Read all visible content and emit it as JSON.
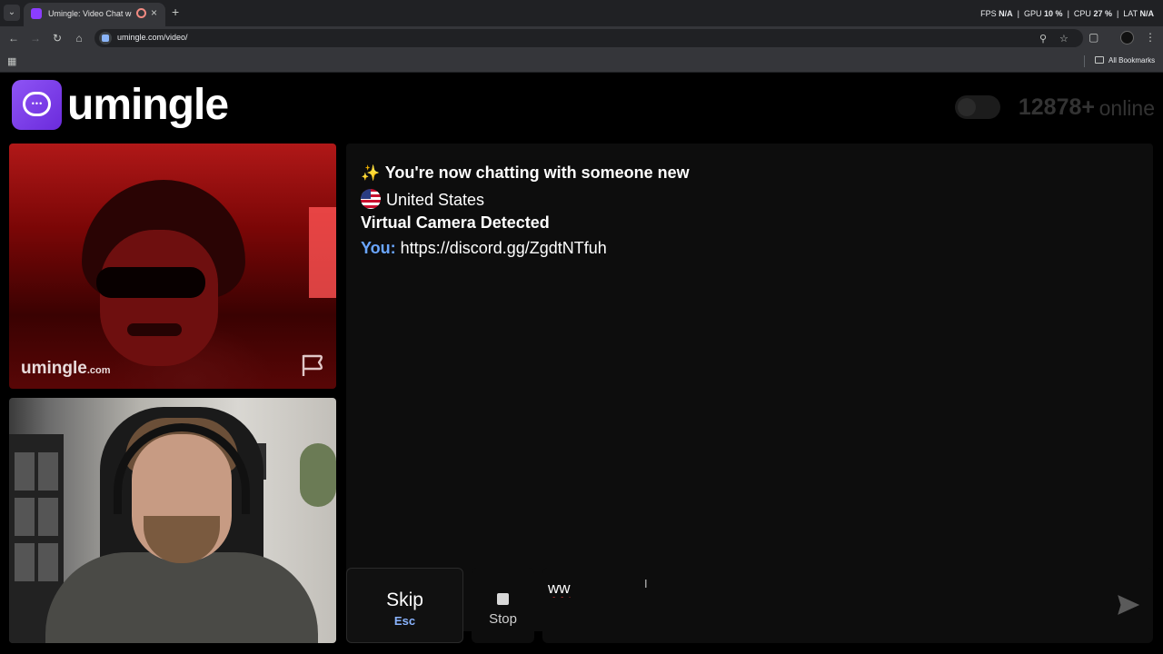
{
  "browser": {
    "tab_title": "Umingle: Video Chat with S",
    "url": "umingle.com/video/",
    "stats": {
      "fps_label": "FPS",
      "fps_value": "N/A",
      "gpu_label": "GPU",
      "gpu_value": "10 %",
      "cpu_label": "CPU",
      "cpu_value": "27 %",
      "lat_label": "LAT",
      "lat_value": "N/A"
    },
    "bookmarks_label": "All Bookmarks",
    "icons": [
      "tab-menu-icon",
      "close-icon",
      "new-tab-icon",
      "back-icon",
      "forward-icon",
      "reload-icon",
      "home-icon",
      "zoom-icon",
      "star-icon",
      "extensions-icon",
      "menu-icon",
      "apps-icon",
      "folder-icon"
    ]
  },
  "header": {
    "logo_text": "umingle",
    "online_count": "12878+",
    "online_label": "online"
  },
  "stranger_video": {
    "brand": "umingle",
    "brand_suffix": ".com"
  },
  "chat": {
    "connected_message": "You're now chatting with someone new",
    "country": "United States",
    "warning": "Virtual Camera Detected",
    "you_label": "You:",
    "you_message": "https://discord.gg/ZgdtNTfuh"
  },
  "controls": {
    "skip_label": "Skip",
    "skip_key": "Esc",
    "stop_label": "Stop",
    "message_value": "ww"
  },
  "colors": {
    "brand_purple": "#8e54f5",
    "you_label": "#6aa6ff",
    "background": "#000000"
  }
}
